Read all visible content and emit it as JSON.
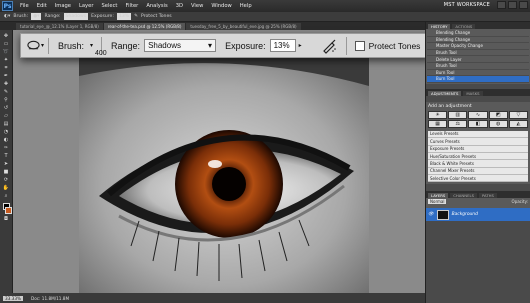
{
  "menubar": {
    "logo": "Ps",
    "items": [
      "File",
      "Edit",
      "Image",
      "Layer",
      "Select",
      "Filter",
      "Analysis",
      "3D",
      "View",
      "Window",
      "Help"
    ],
    "workspace": "MST WORKSPACE"
  },
  "options_bar": {
    "brush_label": "Brush:",
    "range_label": "Range:",
    "range_value": "Shadows",
    "exposure_label": "Exposure:",
    "exposure_value": "13%",
    "protect_label": "Protect Tones"
  },
  "zoomed_options": {
    "brush_label": "Brush:",
    "brush_size": "400",
    "range_label": "Range:",
    "range_value": "Shadows",
    "exposure_label": "Exposure:",
    "exposure_value": "13%",
    "protect_label": "Protect Tones"
  },
  "doc_tabs": [
    "tutorial_eye_@_12.1% (Layer 1, RGB/8)",
    "rear-of-the-tea.psd @ 12.5% (RGB/8)",
    "tuesday_free_5_by_beautiful_eve.jpg @ 25% (RGB/8)"
  ],
  "status": {
    "zoom": "33.33%",
    "doc": "Doc: 11.8M/11.8M"
  },
  "history": {
    "tabs": [
      "HISTORY",
      "ACTIONS"
    ],
    "items": [
      "Blending Change",
      "Blending Change",
      "Master Opacity Change",
      "Brush Tool",
      "Delete Layer",
      "Brush Tool",
      "Burn Tool",
      "Burn Tool"
    ],
    "selected_index": 7
  },
  "adjustments": {
    "tabs": [
      "ADJUSTMENTS",
      "MASKS"
    ],
    "title": "Add an adjustment",
    "presets": [
      "Levels Presets",
      "Curves Presets",
      "Exposure Presets",
      "Hue/Saturation Presets",
      "Black & White Presets",
      "Channel Mixer Presets",
      "Selective Color Presets"
    ]
  },
  "layers": {
    "tabs": [
      "LAYERS",
      "CHANNELS",
      "PATHS"
    ],
    "blend_mode": "Normal",
    "opacity_label": "Opacity:",
    "layer_name": "Background"
  },
  "colors": {
    "accent": "#2f6dc4",
    "fg": "#000000",
    "bg": "#c65a1f"
  }
}
